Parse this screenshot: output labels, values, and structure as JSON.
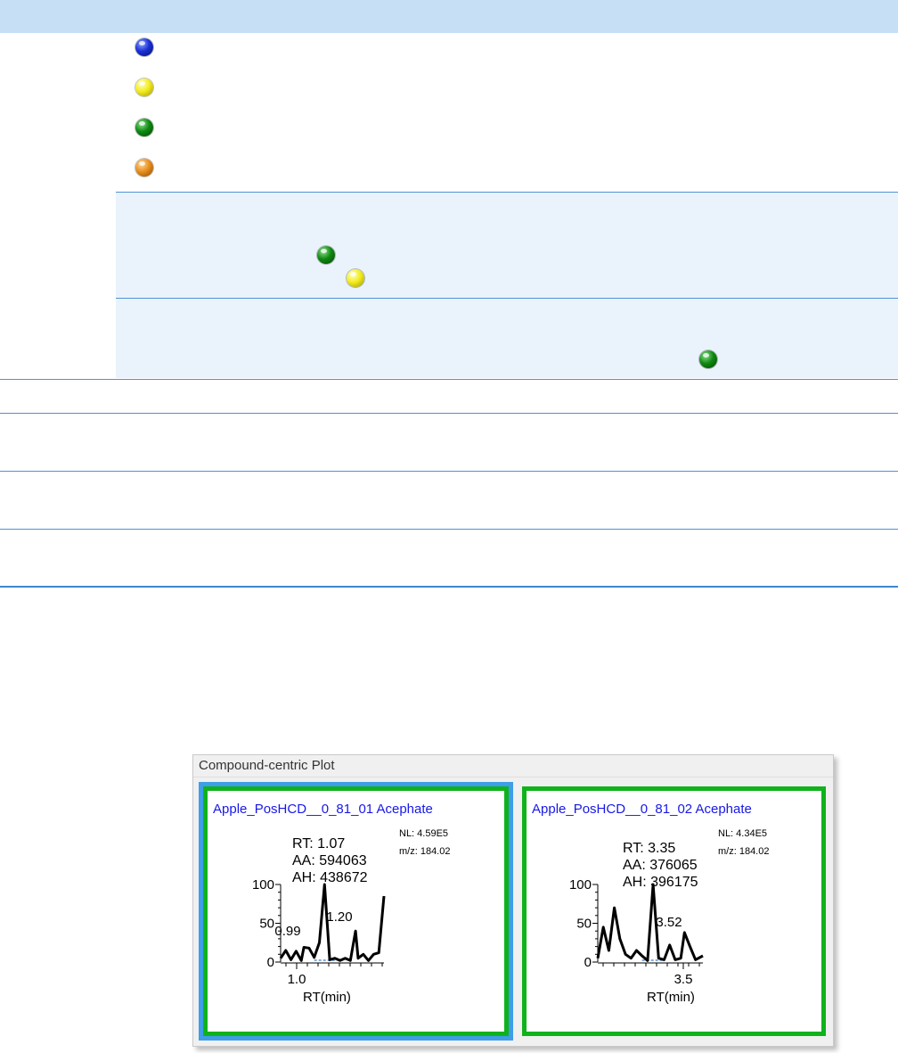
{
  "legend_balls": [
    "blue",
    "yellow",
    "green",
    "orange"
  ],
  "row_balls": [
    {
      "color": "green"
    },
    {
      "color": "yellow"
    },
    {
      "color": "green"
    }
  ],
  "plot_window": {
    "title": "Compound-centric Plot",
    "panels": [
      {
        "title": "Apple_PosHCD__0_81_01   Acephate",
        "nl": "NL: 4.59E5",
        "mz": "m/z: 184.02",
        "rt": "RT: 1.07",
        "aa": "AA: 594063",
        "ah": "AH: 438672",
        "peak_labels": [
          "0.99",
          "1.20"
        ],
        "y_ticks": [
          "100",
          "50",
          "0"
        ],
        "x_tick": "1.0",
        "x_label": "RT(min)",
        "selected": true
      },
      {
        "title": "Apple_PosHCD__0_81_02   Acephate",
        "nl": "NL: 4.34E5",
        "mz": "m/z: 184.02",
        "rt": "RT: 3.35",
        "aa": "AA: 376065",
        "ah": "AH: 396175",
        "peak_labels": [
          "3.52"
        ],
        "y_ticks": [
          "100",
          "50",
          "0"
        ],
        "x_tick": "3.5",
        "x_label": "RT(min)",
        "selected": false
      }
    ]
  },
  "colors": {
    "header": "#c6dff4",
    "panel_border": "#10b21b",
    "selection": "#3e9ee8",
    "title_text": "#1818e8"
  },
  "chart_data": [
    {
      "type": "line",
      "xlabel": "RT(min)",
      "ylabel": "",
      "ylim": [
        0,
        100
      ],
      "x_ticks": [
        1.0
      ],
      "y_ticks": [
        0,
        50,
        100
      ],
      "annotations": [
        "0.99",
        "1.20"
      ],
      "series": [
        {
          "x": [
            0.9,
            0.92,
            0.94,
            0.96,
            0.98,
            0.99,
            1.01,
            1.03,
            1.05,
            1.07,
            1.09,
            1.11,
            1.13,
            1.15,
            1.17,
            1.19,
            1.2,
            1.22,
            1.24,
            1.26,
            1.28,
            1.3
          ],
          "values": [
            5,
            15,
            3,
            14,
            2,
            19,
            18,
            6,
            25,
            100,
            3,
            5,
            2,
            5,
            2,
            40,
            5,
            10,
            2,
            10,
            12,
            85
          ]
        }
      ]
    },
    {
      "type": "line",
      "xlabel": "RT(min)",
      "ylabel": "",
      "ylim": [
        0,
        100
      ],
      "x_ticks": [
        3.5
      ],
      "y_ticks": [
        0,
        50,
        100
      ],
      "annotations": [
        "3.52"
      ],
      "series": [
        {
          "x": [
            3.05,
            3.08,
            3.11,
            3.14,
            3.17,
            3.2,
            3.23,
            3.26,
            3.29,
            3.32,
            3.35,
            3.38,
            3.41,
            3.44,
            3.47,
            3.5,
            3.52,
            3.55,
            3.58,
            3.62
          ],
          "values": [
            5,
            45,
            15,
            70,
            30,
            10,
            5,
            15,
            8,
            2,
            100,
            5,
            3,
            22,
            3,
            5,
            38,
            20,
            3,
            8
          ]
        }
      ]
    }
  ]
}
